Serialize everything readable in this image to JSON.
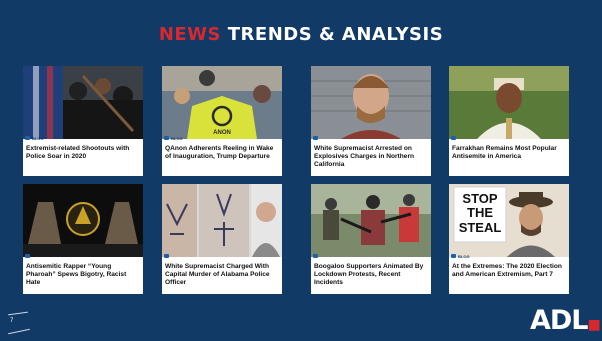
{
  "header": {
    "accent": "NEWS",
    "title": "TRENDS & ANALYSIS"
  },
  "tag_label": "BLOG",
  "cards": [
    {
      "title": "Extremist-related Shootouts with Police Soar in 2020"
    },
    {
      "title": "QAnon Adherents Reeling in Wake of Inauguration, Trump Departure"
    },
    {
      "title": "White Supremacist Arrested on Explosives Charges in Northern California"
    },
    {
      "title": "Farrakhan Remains Most Popular Antisemite in America"
    },
    {
      "title": "Antisemitic Rapper “Young Pharoah” Spews Bigotry, Racist Hate"
    },
    {
      "title": "White Supremacist Charged With Capital Murder of Alabama Police Officer"
    },
    {
      "title": "Boogaloo Supporters Animated By Lockdown Protests, Recent Incidents"
    },
    {
      "title": "At the Extremes: The 2020 Election and American Extremism, Part 7"
    }
  ],
  "thumb_texts": {
    "qanon_vest": "ANON",
    "sign_line1": "STOP",
    "sign_line2": "THE",
    "sign_line3": "STEAL"
  },
  "footer": {
    "page_number": "7",
    "logo": "ADL"
  },
  "colors": {
    "background": "#123a66",
    "accent": "#d8282f",
    "text": "#ffffff"
  }
}
